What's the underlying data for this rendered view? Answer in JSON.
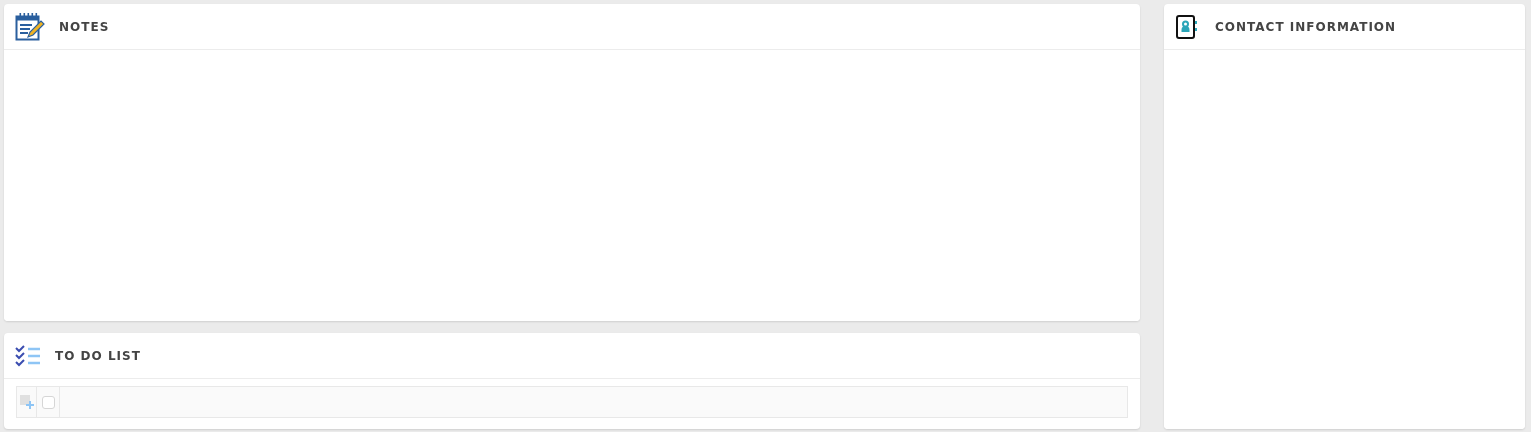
{
  "notes": {
    "title": "NOTES"
  },
  "todo": {
    "title": "TO DO LIST",
    "new_item": {
      "checked": false
    }
  },
  "contact": {
    "title": "CONTACT INFORMATION"
  }
}
